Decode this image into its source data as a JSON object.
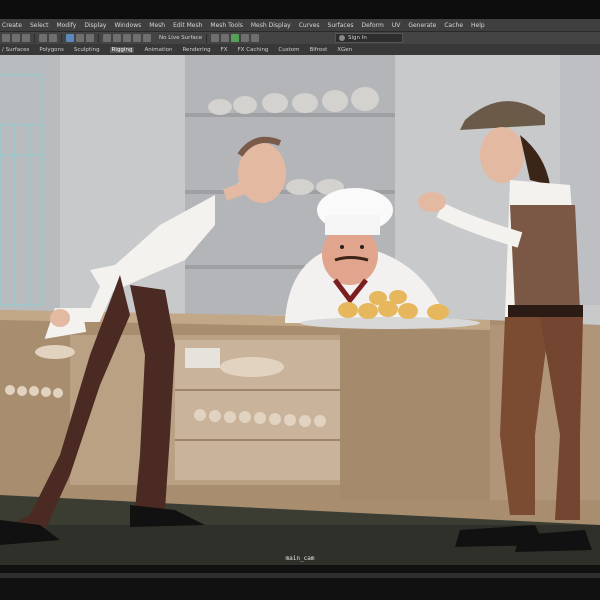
{
  "menu": {
    "items": [
      "Create",
      "Select",
      "Modify",
      "Display",
      "Windows",
      "Mesh",
      "Edit Mesh",
      "Mesh Tools",
      "Mesh Display",
      "Curves",
      "Surfaces",
      "Deform",
      "UV",
      "Generate",
      "Cache",
      "Help"
    ]
  },
  "toolbar": {
    "live_surface": "No Live Surface",
    "sign_in": "Sign In"
  },
  "shelf": {
    "tabs": [
      "/ Surfaces",
      "Polygons",
      "Sculpting",
      "Rigging",
      "Animation",
      "Rendering",
      "FX",
      "FX Caching",
      "Custom",
      "Bifrost",
      "XGen"
    ],
    "active_tab": "Rigging"
  },
  "viewport": {
    "camera_label": "main_cam"
  },
  "colors": {
    "ui_dark": "#3f3f3f",
    "viewport_bg": "#c9c9c9",
    "counter_wood": "#b49a7c"
  }
}
